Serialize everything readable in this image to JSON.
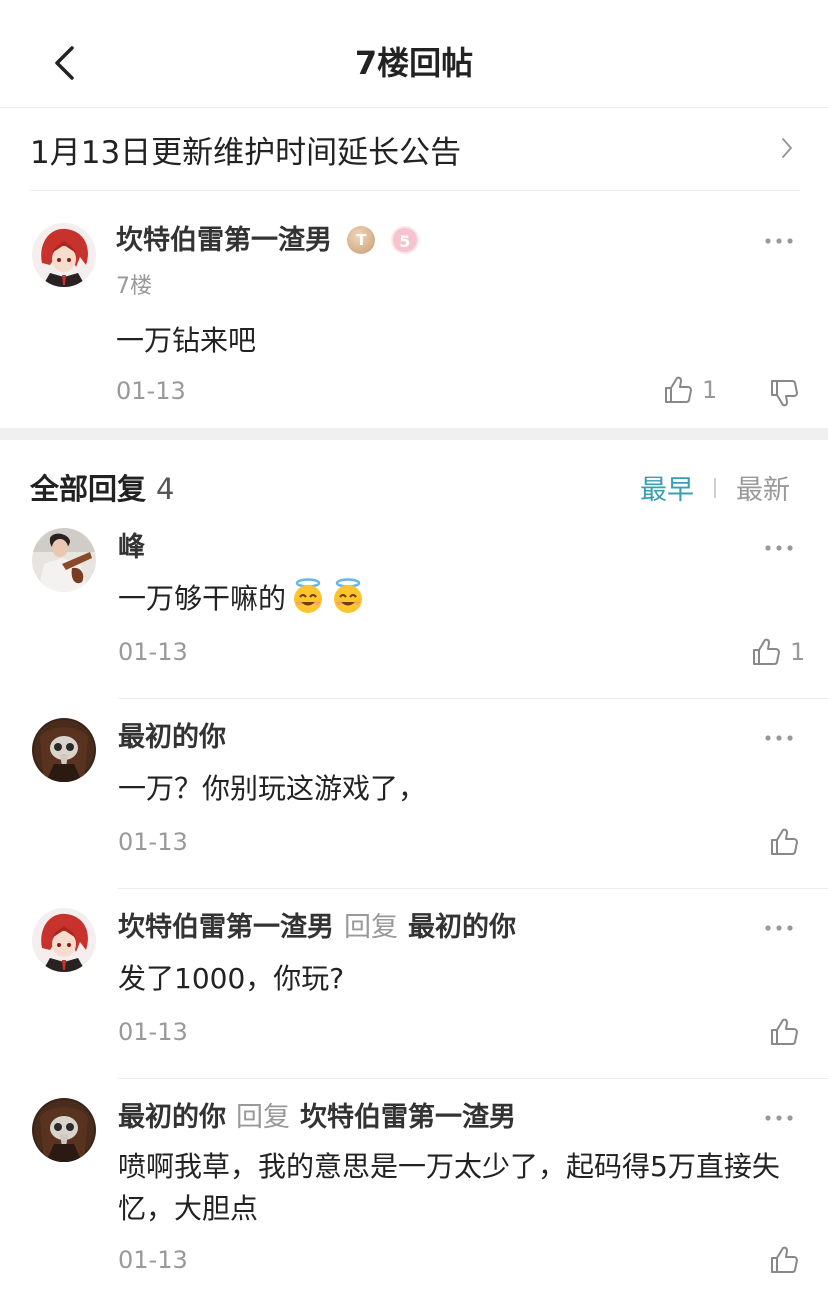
{
  "header": {
    "title": "7楼回帖",
    "back_icon": "chevron-left-icon"
  },
  "notice": {
    "text": "1月13日更新维护时间延长公告",
    "arrow_icon": "chevron-right-icon"
  },
  "post": {
    "author": "坎特伯雷第一渣男",
    "badges": [
      "T",
      "5"
    ],
    "floor": "7楼",
    "content": "一万钻来吧",
    "date": "01-13",
    "likes": "1"
  },
  "replies_header": {
    "title": "全部回复",
    "count": "4",
    "sort_earliest": "最早",
    "sort_latest": "最新",
    "active_color": "#36a0b2"
  },
  "replies": [
    {
      "name": "峰",
      "text": "一万够干嘛的",
      "emojis": [
        "halo-smile-emoji",
        "halo-smile-emoji"
      ],
      "date": "01-13",
      "likes": "1"
    },
    {
      "name": "最初的你",
      "text": "一万？你别玩这游戏了，",
      "date": "01-13",
      "likes": ""
    },
    {
      "name": "坎特伯雷第一渣男",
      "reply_word": "回复",
      "reply_to": "最初的你",
      "text": "发了1000，你玩?",
      "date": "01-13",
      "likes": ""
    },
    {
      "name": "最初的你",
      "reply_word": "回复",
      "reply_to": "坎特伯雷第一渣男",
      "text": "喷啊我草，我的意思是一万太少了，起码得5万直接失忆，大胆点",
      "date": "01-13",
      "likes": ""
    }
  ]
}
